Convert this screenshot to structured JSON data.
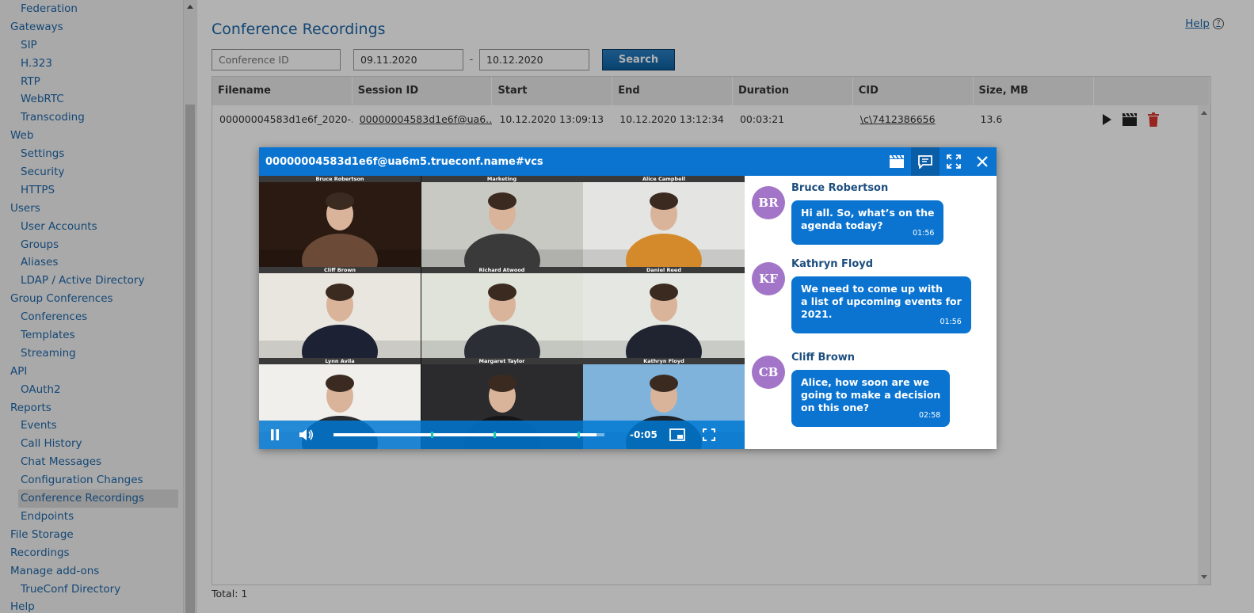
{
  "sidebar": {
    "items": [
      {
        "label": "Federation",
        "level": 1
      },
      {
        "label": "Gateways",
        "level": 0
      },
      {
        "label": "SIP",
        "level": 1
      },
      {
        "label": "H.323",
        "level": 1
      },
      {
        "label": "RTP",
        "level": 1
      },
      {
        "label": "WebRTC",
        "level": 1
      },
      {
        "label": "Transcoding",
        "level": 1
      },
      {
        "label": "Web",
        "level": 0
      },
      {
        "label": "Settings",
        "level": 1
      },
      {
        "label": "Security",
        "level": 1
      },
      {
        "label": "HTTPS",
        "level": 1
      },
      {
        "label": "Users",
        "level": 0
      },
      {
        "label": "User Accounts",
        "level": 1
      },
      {
        "label": "Groups",
        "level": 1
      },
      {
        "label": "Aliases",
        "level": 1
      },
      {
        "label": "LDAP / Active Directory",
        "level": 1
      },
      {
        "label": "Group Conferences",
        "level": 0
      },
      {
        "label": "Conferences",
        "level": 1
      },
      {
        "label": "Templates",
        "level": 1
      },
      {
        "label": "Streaming",
        "level": 1
      },
      {
        "label": "API",
        "level": 0
      },
      {
        "label": "OAuth2",
        "level": 1
      },
      {
        "label": "Reports",
        "level": 0
      },
      {
        "label": "Events",
        "level": 1
      },
      {
        "label": "Call History",
        "level": 1
      },
      {
        "label": "Chat Messages",
        "level": 1
      },
      {
        "label": "Configuration Changes",
        "level": 1
      },
      {
        "label": "Conference Recordings",
        "level": 1,
        "active": true
      },
      {
        "label": "Endpoints",
        "level": 1
      },
      {
        "label": "File Storage",
        "level": 0
      },
      {
        "label": "Recordings",
        "level": 0
      },
      {
        "label": "Manage add-ons",
        "level": 0
      },
      {
        "label": "TrueConf Directory",
        "level": 1
      },
      {
        "label": "Help",
        "level": 0
      }
    ]
  },
  "page": {
    "title": "Conference Recordings",
    "help_label": "Help",
    "help_icon": "?"
  },
  "filter": {
    "conference_id_placeholder": "Conference ID",
    "date_from": "09.11.2020",
    "date_separator": "-",
    "date_to": "10.12.2020",
    "search_label": "Search"
  },
  "table": {
    "headers": [
      "Filename",
      "Session ID",
      "Start",
      "End",
      "Duration",
      "CID",
      "Size, MB"
    ],
    "rows": [
      {
        "filename": "00000004583d1e6f_2020-...",
        "session_id": "00000004583d1e6f@ua6...",
        "start": "10.12.2020 13:09:13",
        "end": "10.12.2020 13:12:34",
        "duration": "00:03:21",
        "cid": "\\c\\7412386656",
        "size": "13.6"
      }
    ],
    "total_label": "Total: 1"
  },
  "modal": {
    "title": "00000004583d1e6f@ua6m5.trueconf.name#vcs",
    "tiles": [
      {
        "name": "Bruce Robertson",
        "bg": "#2a1a12",
        "fg": "#6b4a38"
      },
      {
        "name": "Marketing",
        "bg": "#c9c9c4",
        "fg": "#3a3a3a"
      },
      {
        "name": "Alice Campbell",
        "bg": "#e4e4e2",
        "fg": "#d48a2a"
      },
      {
        "name": "Cliff Brown",
        "bg": "#e9e6e0",
        "fg": "#1c2233"
      },
      {
        "name": "Richard Atwood",
        "bg": "#dfe3da",
        "fg": "#2b2f35"
      },
      {
        "name": "Daniel Reed",
        "bg": "#e5e7e2",
        "fg": "#1f2430"
      },
      {
        "name": "Lynn Avila",
        "bg": "#f0efec",
        "fg": "#2a2a2e"
      },
      {
        "name": "Margaret Taylor",
        "bg": "#2b2a2c",
        "fg": "#151417"
      },
      {
        "name": "Kathryn Floyd",
        "bg": "#7fb3dc",
        "fg": "#1f2226"
      }
    ],
    "player": {
      "time_remaining": "-0:05",
      "progress": 0.97,
      "markers": [
        0.36,
        0.59,
        0.9
      ]
    },
    "chat": [
      {
        "initials": "BR",
        "sender": "Bruce Robertson",
        "text": "Hi all. So, what’s on the\nagenda today?",
        "time": "01:56"
      },
      {
        "initials": "KF",
        "sender": "Kathryn Floyd",
        "text": "We need to come up with\na list of upcoming events for\n2021.",
        "time": "01:56"
      },
      {
        "initials": "CB",
        "sender": "Cliff Brown",
        "text": "Alice, how soon are we\ngoing to make a decision\non this one?",
        "time": "02:58"
      }
    ]
  },
  "colors": {
    "accent": "#0b74d1",
    "link": "#1e66a8",
    "avatar": "#a375c8",
    "delete": "#d9342b"
  }
}
